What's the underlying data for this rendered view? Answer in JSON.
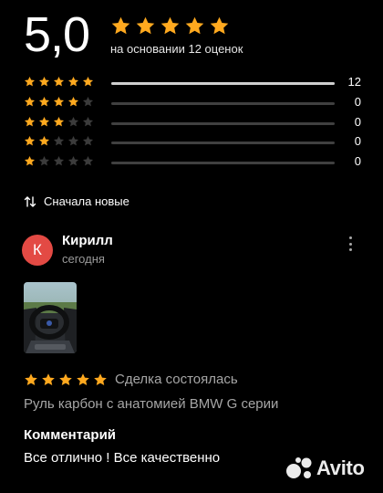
{
  "summary": {
    "score": "5,0",
    "caption": "на основании 12 оценок",
    "stars_filled": 5
  },
  "distribution": [
    {
      "stars": 5,
      "count": "12",
      "share": 1.0
    },
    {
      "stars": 4,
      "count": "0",
      "share": 0
    },
    {
      "stars": 3,
      "count": "0",
      "share": 0
    },
    {
      "stars": 2,
      "count": "0",
      "share": 0
    },
    {
      "stars": 1,
      "count": "0",
      "share": 0
    }
  ],
  "sort": {
    "label": "Сначала новые",
    "icon": "sort-arrows-icon"
  },
  "review": {
    "avatar_letter": "К",
    "avatar_color": "#e34a44",
    "author": "Кирилл",
    "date": "сегодня",
    "rating": 5,
    "deal_status": "Сделка состоялась",
    "product": "Руль карбон с анатомией BMW G серии",
    "comment_heading": "Комментарий",
    "comment": "Все отлично ! Все качественно"
  },
  "watermark": {
    "logo": "Avito"
  },
  "colors": {
    "star_filled": "#ffa91f",
    "star_empty": "#3b3b3b",
    "background": "#000000",
    "secondary_text": "#a6a6a6"
  }
}
